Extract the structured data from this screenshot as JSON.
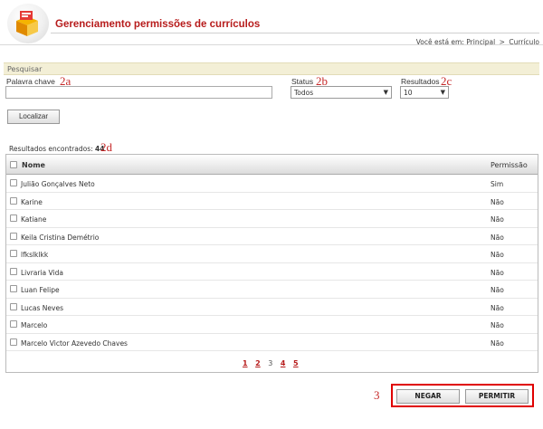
{
  "header": {
    "title": "Gerenciamento permissões de currículos",
    "breadcrumb_prefix": "Você está em:",
    "breadcrumb_home": "Principal",
    "breadcrumb_sep": ">",
    "breadcrumb_current": "Currículo"
  },
  "search": {
    "section_title": "Pesquisar",
    "keyword_label": "Palavra chave",
    "keyword_value": "",
    "status_label": "Status",
    "status_value": "Todos",
    "results_label": "Resultados",
    "results_value": "10",
    "button": "Localizar"
  },
  "annotations": {
    "keyword": "2a",
    "status": "2b",
    "results": "2c",
    "count": "2d",
    "actions": "3"
  },
  "results": {
    "label": "Resultados encontrados:",
    "count": "44"
  },
  "table": {
    "col_name": "Nome",
    "col_permission": "Permissão",
    "rows": [
      {
        "name": "Julião Gonçalves Neto",
        "permission": "Sim"
      },
      {
        "name": "Karine",
        "permission": "Não"
      },
      {
        "name": "Katiane",
        "permission": "Não"
      },
      {
        "name": "Keila Cristina Demétrio",
        "permission": "Não"
      },
      {
        "name": "lfkslklkk",
        "permission": "Não"
      },
      {
        "name": "Livraria Vida",
        "permission": "Não"
      },
      {
        "name": "Luan Felipe",
        "permission": "Não"
      },
      {
        "name": "Lucas Neves",
        "permission": "Não"
      },
      {
        "name": "Marcelo",
        "permission": "Não"
      },
      {
        "name": "Marcelo Victor Azevedo Chaves",
        "permission": "Não"
      }
    ]
  },
  "pagination": {
    "pages": [
      "1",
      "2",
      "3",
      "4",
      "5"
    ],
    "current": "3"
  },
  "actions": {
    "deny": "NEGAR",
    "allow": "PERMITIR"
  },
  "colors": {
    "brand_red": "#b71c1c",
    "annotation_red": "#c62828",
    "highlight_frame": "#e00000",
    "section_bar": "#f3efd6"
  }
}
